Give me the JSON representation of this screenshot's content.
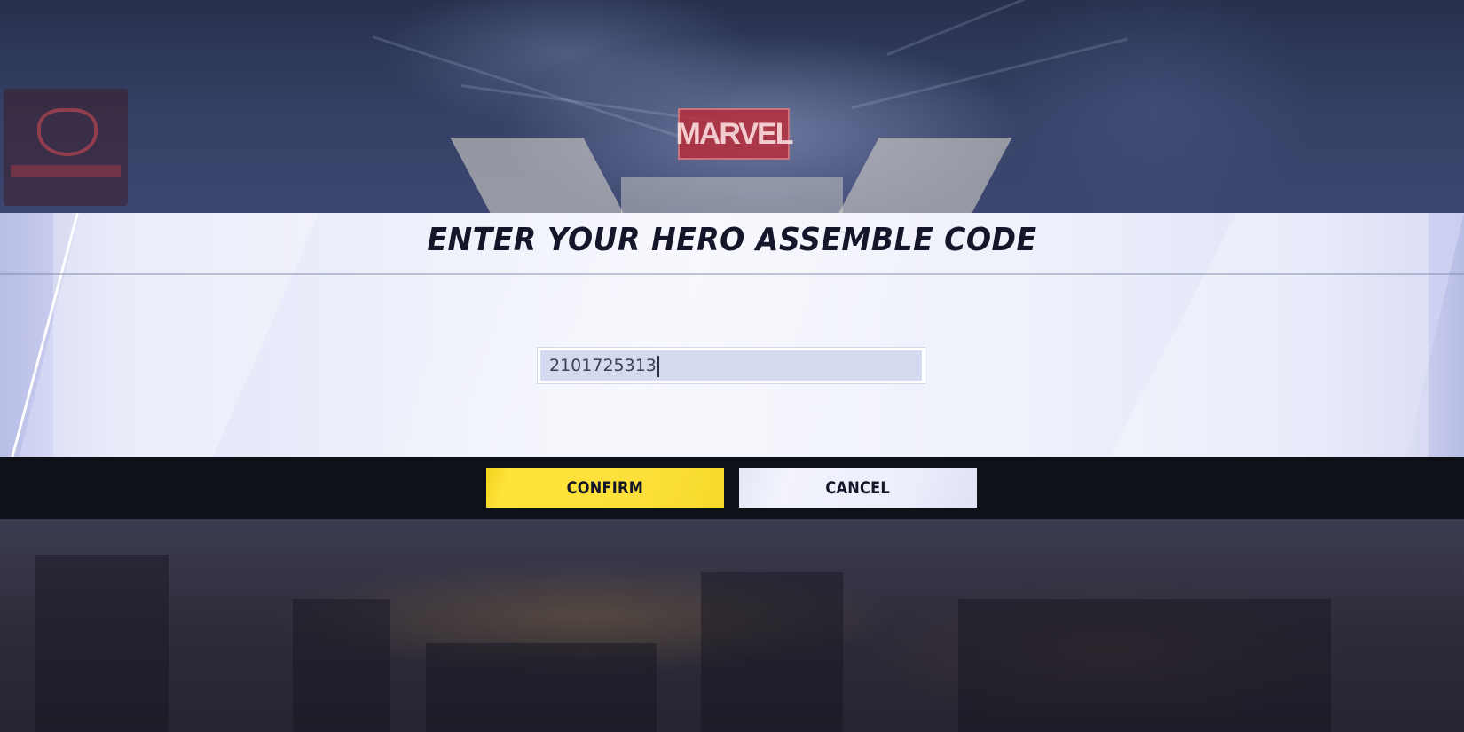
{
  "dialog": {
    "title": "ENTER YOUR HERO ASSEMBLE CODE",
    "code_input": {
      "value": "2101725313",
      "placeholder": ""
    },
    "buttons": {
      "confirm_label": "CONFIRM",
      "cancel_label": "CANCEL"
    }
  },
  "background": {
    "logo_text": "MARVEL"
  },
  "colors": {
    "confirm_button": "#fde03a",
    "cancel_button": "#eceefb",
    "action_bar": "#0f1119",
    "panel": "#f4f5fc",
    "title_text": "#14172a"
  },
  "icons": {
    "background_logo": "marvel-logo-icon",
    "corner_emblem": "team-emblem-icon"
  }
}
